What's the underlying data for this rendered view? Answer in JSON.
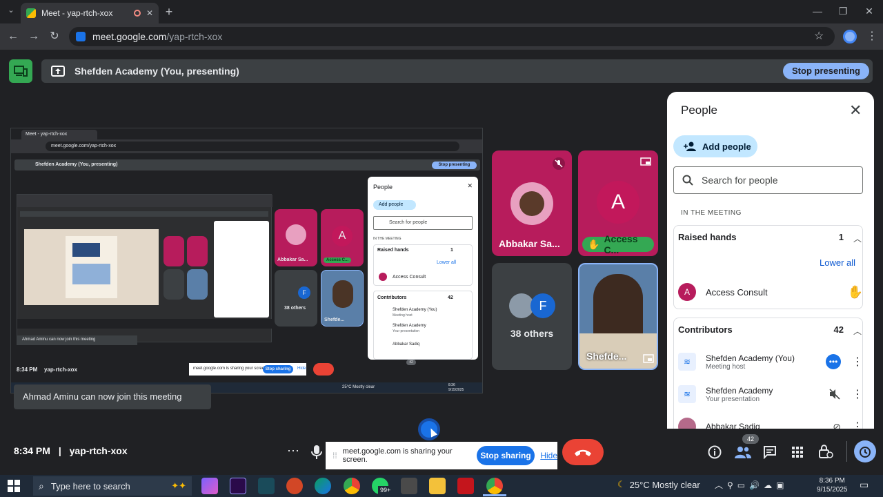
{
  "browser": {
    "tab_title": "Meet - yap-rtch-xox",
    "url_host": "meet.google.com",
    "url_path": "/yap-rtch-xox"
  },
  "presenting": {
    "label": "Shefden Academy (You, presenting)",
    "stop_label": "Stop presenting"
  },
  "share_preview": {
    "tab_title": "Meet - yap-rtch-xox",
    "url": "meet.google.com/yap-rtch-xox",
    "present_label": "Shefden Academy (You, presenting)",
    "stop_label": "Stop presenting",
    "people_title": "People",
    "add_people": "Add people",
    "search": "Search for people",
    "in_meeting": "IN THE MEETING",
    "raised_hands": "Raised hands",
    "raised_count": "1",
    "lower_all": "Lower all",
    "access_consult": "Access Consult",
    "contributors": "Contributors",
    "contributors_count": "42",
    "c1_name": "Shefden Academy (You)",
    "c1_sub": "Meeting host",
    "c2_name": "Shefden Academy",
    "c2_sub": "Your presentation",
    "c3_name": "Abbakar Sadiq",
    "tile_abbakar": "Abbakar Sa...",
    "tile_access": "Access C...",
    "tile_others": "38 others",
    "tile_shefden": "Shefde...",
    "toast": "Ahmad Aminu can now join this meeting",
    "time": "8:34 PM",
    "code": "yap-rtch-xox",
    "sharing_text": "meet.google.com is sharing your screen.",
    "stop_sharing": "Stop sharing",
    "hide": "Hide",
    "badge": "42",
    "weather": "25°C  Mostly clear",
    "clock_time": "8:36",
    "clock_date": "9/15/2025"
  },
  "tiles": {
    "abbakar": "Abbakar Sa...",
    "access": "Access C...",
    "access_initial": "A",
    "others": "38 others",
    "others_initial": "F",
    "shefden": "Shefde..."
  },
  "people_panel": {
    "title": "People",
    "add_people": "Add people",
    "search_placeholder": "Search for people",
    "in_meeting": "IN THE MEETING",
    "raised_hands": {
      "label": "Raised hands",
      "count": "1",
      "lower_all": "Lower all",
      "person": "Access Consult",
      "initial": "A"
    },
    "contributors": {
      "label": "Contributors",
      "count": "42",
      "items": [
        {
          "name": "Shefden Academy (You)",
          "sub": "Meeting host"
        },
        {
          "name": "Shefden Academy",
          "sub": "Your presentation"
        },
        {
          "name": "Abbakar Sadiq",
          "sub": ""
        }
      ]
    }
  },
  "meeting": {
    "toast": "Ahmad Aminu can now join this meeting",
    "time": "8:34 PM",
    "separator": "|",
    "code": "yap-rtch-xox",
    "sharing_text": "meet.google.com is sharing your screen.",
    "stop_sharing": "Stop sharing",
    "hide": "Hide",
    "people_badge": "42"
  },
  "taskbar": {
    "search_placeholder": "Type here to search",
    "whatsapp_badge": "99+",
    "weather": "25°C  Mostly clear",
    "clock_time": "8:36 PM",
    "clock_date": "9/15/2025"
  },
  "colors": {
    "tile_magenta": "#b71c5c",
    "accent_blue": "#8ab4f8",
    "present_green": "#34a853",
    "hangup_red": "#ea4335"
  }
}
